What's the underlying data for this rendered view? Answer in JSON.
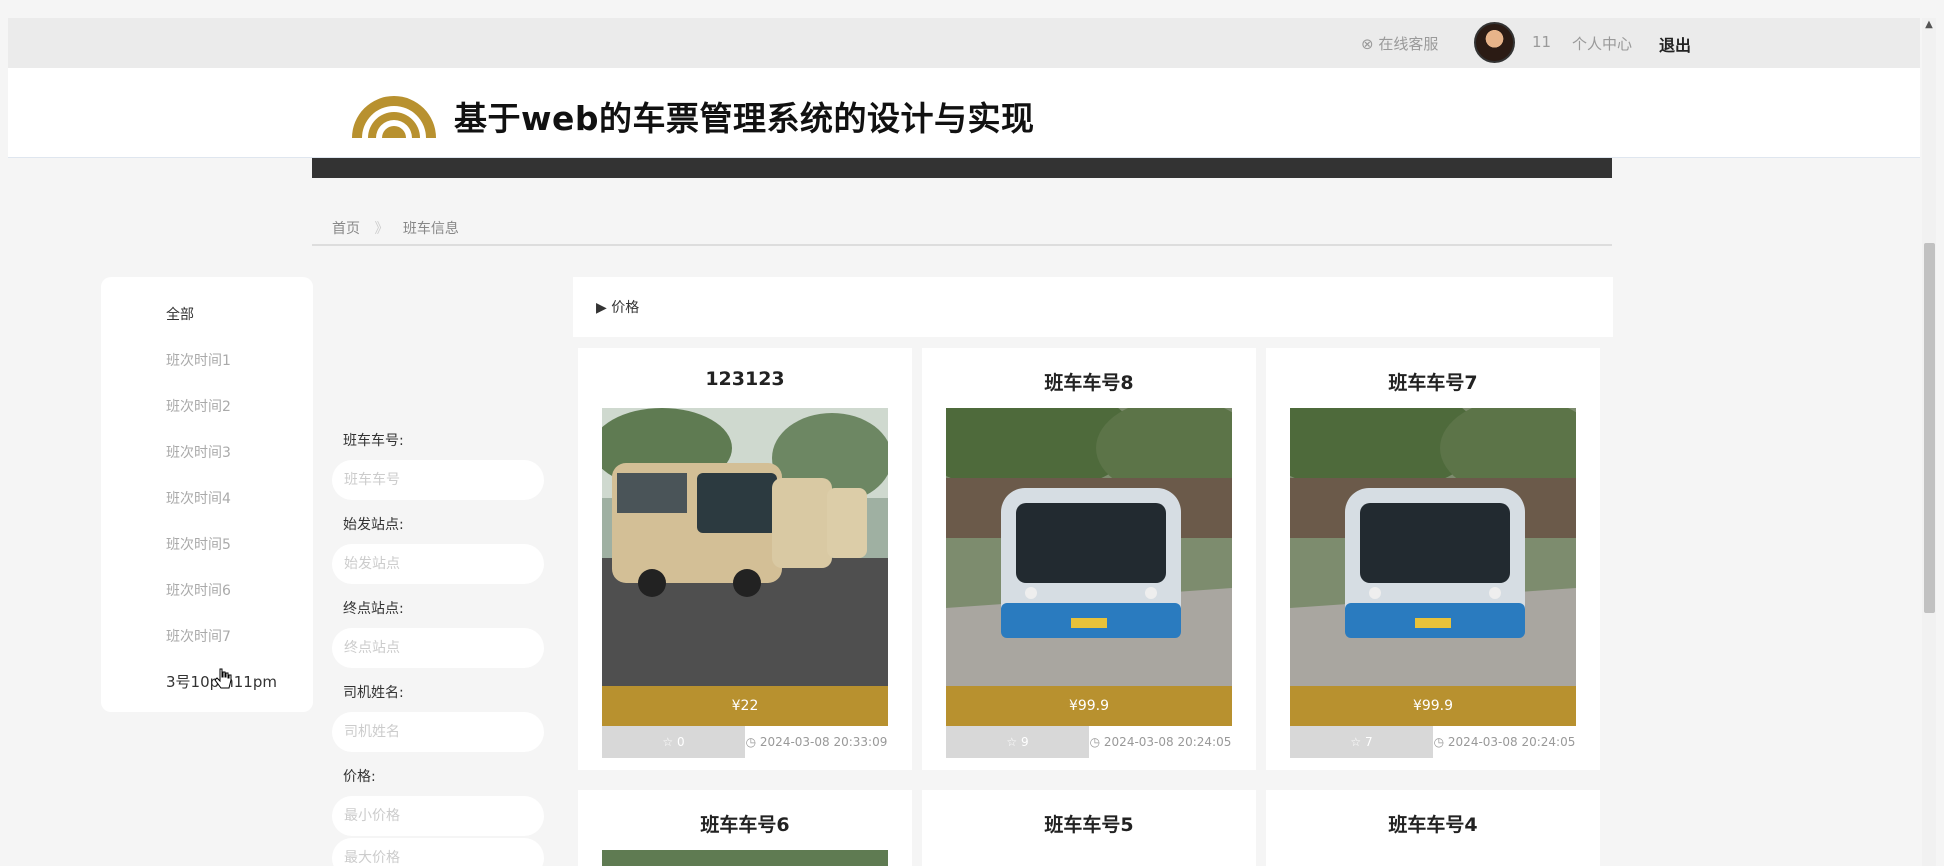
{
  "topbar": {
    "service": "⊗ 在线客服",
    "username": "11",
    "user_center": "个人中心",
    "logout": "退出"
  },
  "header": {
    "title": "基于web的车票管理系统的设计与实现"
  },
  "breadcrumb": {
    "home": "首页",
    "sep": "》",
    "current": "班车信息"
  },
  "categories": [
    {
      "label": "全部"
    },
    {
      "label": "班次时间1"
    },
    {
      "label": "班次时间2"
    },
    {
      "label": "班次时间3"
    },
    {
      "label": "班次时间4"
    },
    {
      "label": "班次时间5"
    },
    {
      "label": "班次时间6"
    },
    {
      "label": "班次时间7"
    },
    {
      "label": "3号10pm11pm"
    }
  ],
  "search": {
    "bus_no_label": "班车车号:",
    "bus_no_placeholder": "班车车号",
    "start_label": "始发站点:",
    "start_placeholder": "始发站点",
    "end_label": "终点站点:",
    "end_placeholder": "终点站点",
    "driver_label": "司机姓名:",
    "driver_placeholder": "司机姓名",
    "price_label": "价格:",
    "min_price_placeholder": "最小价格",
    "max_price_placeholder": "最大价格"
  },
  "sort": {
    "label": "▶ 价格"
  },
  "cards": [
    {
      "title": "123123",
      "price": "¥22",
      "likes": "☆ 0",
      "time": "◷ 2024-03-08 20:33:09"
    },
    {
      "title": "班车车号8",
      "price": "¥99.9",
      "likes": "☆ 9",
      "time": "◷ 2024-03-08 20:24:05"
    },
    {
      "title": "班车车号7",
      "price": "¥99.9",
      "likes": "☆ 7",
      "time": "◷ 2024-03-08 20:24:05"
    },
    {
      "title": "班车车号6"
    },
    {
      "title": "班车车号5"
    },
    {
      "title": "班车车号4"
    }
  ],
  "colors": {
    "accent": "#b8912f",
    "dark_bar": "#333333"
  }
}
